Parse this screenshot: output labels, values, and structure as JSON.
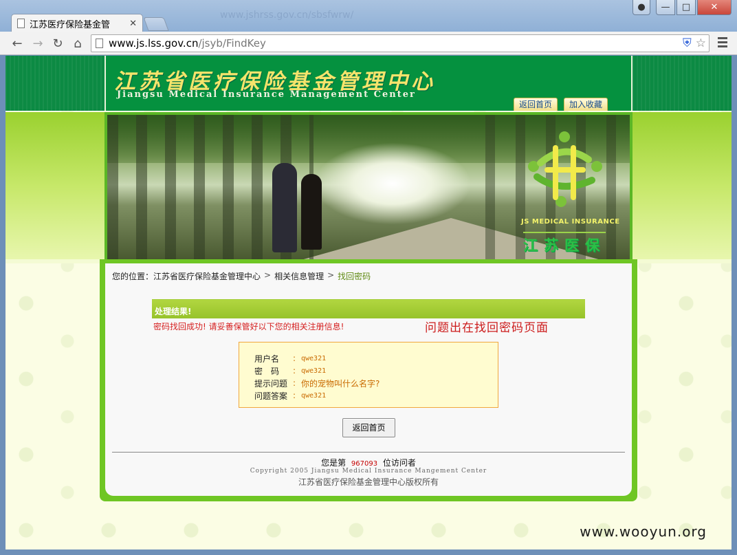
{
  "browser": {
    "tab_title": "江苏医疗保险基金管",
    "tab_close": "✕",
    "ghost_url": "www.jshrss.gov.cn/sbsfwrw/",
    "url_host": "www.js.lss.gov.cn",
    "url_path": "/jsyb/FindKey",
    "back_icon": "arrow-left-icon",
    "forward_icon": "arrow-right-icon",
    "reload_icon": "reload-icon",
    "home_icon": "home-icon"
  },
  "header": {
    "title_cn": "江苏省医疗保险基金管理中心",
    "title_en": "Jiangsu Medical Insurance Management Center",
    "link_home": "返回首页",
    "link_favorite": "加入收藏"
  },
  "banner": {
    "badge_en": "JS MEDICAL INSURANCE",
    "badge_cn": "江苏医保"
  },
  "breadcrumb": {
    "prefix": "您的位置：",
    "items": [
      "江苏省医疗保险基金管理中心",
      "相关信息管理",
      "找回密码"
    ],
    "separator": ">"
  },
  "result": {
    "bar_title": "处理结果!",
    "success_message": "密码找回成功! 请妥善保管好以下您的相关注册信息!",
    "annotation": "问题出在找回密码页面"
  },
  "info": {
    "rows": [
      {
        "label": "用户名",
        "colon": ":",
        "value": "qwe321"
      },
      {
        "label": "密　码",
        "colon": ":",
        "value": "qwe321"
      },
      {
        "label": "提示问题",
        "colon": ":",
        "value": "你的宠物叫什么名字?"
      },
      {
        "label": "问题答案",
        "colon": ":",
        "value": "qwe321"
      }
    ]
  },
  "actions": {
    "back_home": "返回首页"
  },
  "footer": {
    "visitors_prefix": "您是第",
    "visitors_count": "967093",
    "visitors_suffix": "位访问者",
    "copyright": "Copyright 2005 Jiangsu Medical Insurance Mangement Center",
    "rights": "江苏省医疗保险基金管理中心版权所有"
  },
  "watermark": "www.wooyun.org",
  "colors": {
    "header_green": "#05913f",
    "accent_lime": "#97c32a",
    "error_red": "#d51f1f",
    "value_orange": "#c96a00"
  }
}
